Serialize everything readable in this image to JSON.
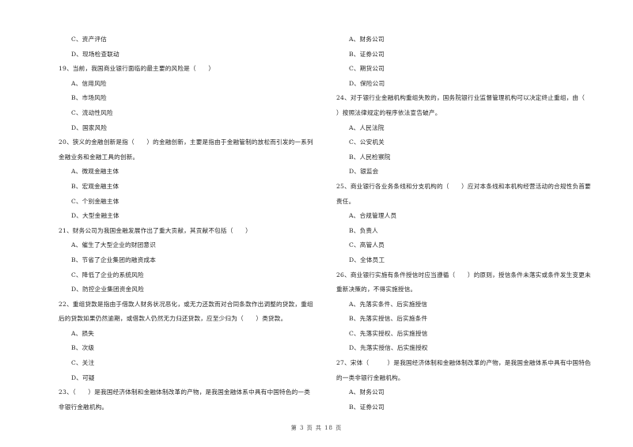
{
  "page": {
    "footer": "第 3 页 共 18 页"
  },
  "left": [
    {
      "type": "opt",
      "text": "C、资产评估"
    },
    {
      "type": "opt",
      "text": "D、现场检查联动"
    },
    {
      "type": "q",
      "text": "19、当前，我国商业银行面临的最主要的风险是（　　）"
    },
    {
      "type": "opt",
      "text": "A、信用风险"
    },
    {
      "type": "opt",
      "text": "B、市场风险"
    },
    {
      "type": "opt",
      "text": "C、流动性风险"
    },
    {
      "type": "opt",
      "text": "D、国家风险"
    },
    {
      "type": "q",
      "text": "20、狭义的金融创新是指（　　）的金融创新，主要是指由于金融管制的放松而引发的一系列"
    },
    {
      "type": "q",
      "text": "金融业务和金融工具的创新。"
    },
    {
      "type": "opt",
      "text": "A、微观金融主体"
    },
    {
      "type": "opt",
      "text": "B、宏观金融主体"
    },
    {
      "type": "opt",
      "text": "C、个别金融主体"
    },
    {
      "type": "opt",
      "text": "D、大型金融主体"
    },
    {
      "type": "q",
      "text": "21、财务公司为我国金融发展作出了重大贡献，其贡献不包括（　　）"
    },
    {
      "type": "opt",
      "text": "A、催生了大型企业的财团意识"
    },
    {
      "type": "opt",
      "text": "B、节省了企业集团的融资成本"
    },
    {
      "type": "opt",
      "text": "C、降低了企业的系统风险"
    },
    {
      "type": "opt",
      "text": "D、防控企业集团资金风险"
    },
    {
      "type": "q",
      "text": "22、重组贷款是指由于借款人财务状况恶化，或无力还款而对合同条款作出调整的贷款，重组"
    },
    {
      "type": "q",
      "text": "后的贷款如果仍然逾期，或借款人仍然无力归还贷款，应至少归为（　　）类贷款。"
    },
    {
      "type": "opt",
      "text": "A、损失"
    },
    {
      "type": "opt",
      "text": "B、次级"
    },
    {
      "type": "opt",
      "text": "C、关注"
    },
    {
      "type": "opt",
      "text": "D、可疑"
    },
    {
      "type": "q",
      "text": "23、（　　）是我国经济体制和金融体制改革的产物，是我国金融体系中具有中国特色的一类"
    },
    {
      "type": "q",
      "text": "非银行金融机构。"
    }
  ],
  "right": [
    {
      "type": "opt",
      "text": "A、财务公司"
    },
    {
      "type": "opt",
      "text": "B、证券公司"
    },
    {
      "type": "opt",
      "text": "C、期货公司"
    },
    {
      "type": "opt",
      "text": "D、保险公司"
    },
    {
      "type": "q",
      "text": "24、对于银行业金融机构重组失败的，国务院银行业监督管理机构可以决定终止重组，由（"
    },
    {
      "type": "q",
      "text": "）按照法律规定的程序依法宣告破产。"
    },
    {
      "type": "opt",
      "text": "A、人民法院"
    },
    {
      "type": "opt",
      "text": "C、公安机关"
    },
    {
      "type": "opt",
      "text": "B、人民检察院"
    },
    {
      "type": "opt",
      "text": "D、银监会"
    },
    {
      "type": "q",
      "text": "25、商业银行各业务条线和分支机构的（　　）应对本条线和本机构经营活动的合规性负首要"
    },
    {
      "type": "q",
      "text": "责任。"
    },
    {
      "type": "opt",
      "text": "A、合规管理人员"
    },
    {
      "type": "opt",
      "text": "B、负责人"
    },
    {
      "type": "opt",
      "text": "C、高管人员"
    },
    {
      "type": "opt",
      "text": "D、全体员工"
    },
    {
      "type": "q",
      "text": "26、商业银行实施有条件授信时应当遵循（　　）的原则，授信条件未落实或条件发生变更未"
    },
    {
      "type": "q",
      "text": "重新决策的，不得实施授信。"
    },
    {
      "type": "opt",
      "text": "A、先落实条件、后实施授信"
    },
    {
      "type": "opt",
      "text": "B、先落实授信、后实施条件"
    },
    {
      "type": "opt",
      "text": "C、先落实授权、后实施授信"
    },
    {
      "type": "opt",
      "text": "D、先落实授信、后实施授权"
    },
    {
      "type": "q",
      "text": "27、宋体（　　　）是我国经济体制和金融体制改革的产物，是我国金融体系中具有中国特色"
    },
    {
      "type": "q",
      "text": "的一类非银行金融机构。"
    },
    {
      "type": "opt",
      "text": "A、财务公司"
    },
    {
      "type": "opt",
      "text": "B、证券公司"
    }
  ]
}
